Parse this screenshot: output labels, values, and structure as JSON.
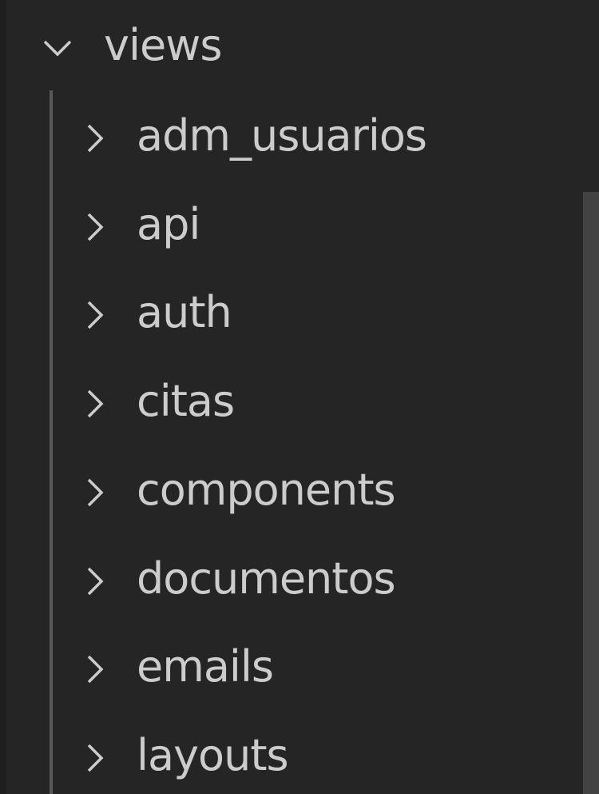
{
  "explorer": {
    "root_folder": {
      "label": "views",
      "expanded": true,
      "twisty_icon": "chevron-down-icon"
    },
    "children": [
      {
        "label": "adm_usuarios",
        "twisty_icon": "chevron-right-icon"
      },
      {
        "label": "api",
        "twisty_icon": "chevron-right-icon"
      },
      {
        "label": "auth",
        "twisty_icon": "chevron-right-icon"
      },
      {
        "label": "citas",
        "twisty_icon": "chevron-right-icon"
      },
      {
        "label": "components",
        "twisty_icon": "chevron-right-icon"
      },
      {
        "label": "documentos",
        "twisty_icon": "chevron-right-icon"
      },
      {
        "label": "emails",
        "twisty_icon": "chevron-right-icon"
      },
      {
        "label": "layouts",
        "twisty_icon": "chevron-right-icon"
      }
    ]
  },
  "colors": {
    "background": "#252526",
    "text": "#cccccc",
    "indent_guide": "#585858",
    "scrollbar_thumb": "#424242"
  }
}
